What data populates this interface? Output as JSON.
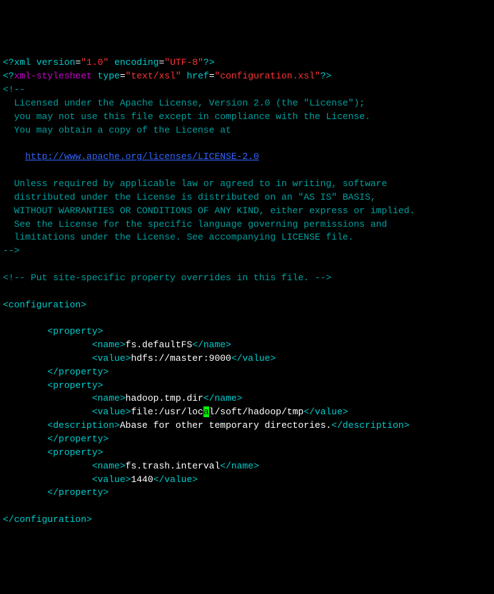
{
  "xml_decl": {
    "open": "<?",
    "name": "xml",
    "attr_version": " version",
    "eq": "=",
    "val_version": "\"1.0\"",
    "attr_encoding": " encoding",
    "val_encoding": "\"UTF-8\"",
    "close": "?>"
  },
  "stylesheet": {
    "open": "<?",
    "name": "xml-stylesheet",
    "attr_type": " type",
    "eq": "=",
    "val_type": "\"text/xsl\"",
    "attr_href": " href",
    "val_href": "\"configuration.xsl\"",
    "close": "?>"
  },
  "comment_open": "<!--",
  "license": {
    "l1": "  Licensed under the Apache License, Version 2.0 (the \"License\");",
    "l2": "  you may not use this file except in compliance with the License.",
    "l3": "  You may obtain a copy of the License at",
    "l4": "    ",
    "url": "http://www.apache.org/licenses/LICENSE-2.0",
    "l5": "  Unless required by applicable law or agreed to in writing, software",
    "l6": "  distributed under the License is distributed on an \"AS IS\" BASIS,",
    "l7": "  WITHOUT WARRANTIES OR CONDITIONS OF ANY KIND, either express or implied.",
    "l8": "  See the License for the specific language governing permissions and",
    "l9": "  limitations under the License. See accompanying LICENSE file."
  },
  "comment_close": "-->",
  "site_comment": "<!-- Put site-specific property overrides in this file. -->",
  "tags": {
    "configuration_open": "<configuration>",
    "configuration_close": "</configuration>",
    "property_open": "<property>",
    "property_close": "</property>",
    "name_open": "<name>",
    "name_close": "</name>",
    "value_open": "<value>",
    "value_close": "</value>",
    "description_open": "<description>",
    "description_close": "</description>"
  },
  "properties": {
    "p1": {
      "name": "fs.defaultFS",
      "value": "hdfs://master:9000"
    },
    "p2": {
      "name": "hadoop.tmp.dir",
      "value_a": "file:/usr/loc",
      "cursor": "a",
      "value_b": "l/soft/hadoop/tmp",
      "description": "Abase for other temporary directories."
    },
    "p3": {
      "name": "fs.trash.interval",
      "value": "1440"
    }
  },
  "indent": {
    "i2": "        ",
    "i4": "                "
  }
}
